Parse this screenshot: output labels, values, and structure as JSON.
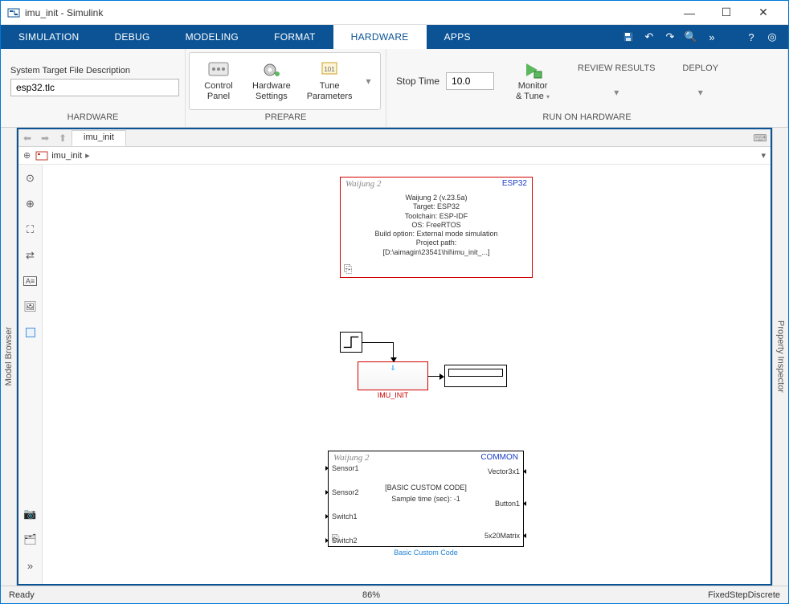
{
  "window": {
    "title": "imu_init - Simulink"
  },
  "tabs": [
    "SIMULATION",
    "DEBUG",
    "MODELING",
    "FORMAT",
    "HARDWARE",
    "APPS"
  ],
  "activeTab": "HARDWARE",
  "ribbon": {
    "hardware": {
      "targetLabel": "System Target File Description",
      "targetValue": "esp32.tlc",
      "groupLabel": "HARDWARE"
    },
    "prepare": {
      "controlPanel": "Control\nPanel",
      "hwSettings": "Hardware\nSettings",
      "tuneParams": "Tune\nParameters",
      "groupLabel": "PREPARE"
    },
    "run": {
      "stopTimeLabel": "Stop Time",
      "stopTimeValue": "10.0",
      "monitor": "Monitor\n& Tune",
      "review": "REVIEW RESULTS",
      "deploy": "DEPLOY",
      "groupLabel": "RUN ON HARDWARE"
    }
  },
  "fileTab": "imu_init",
  "breadcrumb": "imu_init",
  "sidebars": {
    "left": "Model Browser",
    "right": "Property Inspector"
  },
  "blocks": {
    "target": {
      "brand": "Waijung 2",
      "tag": "ESP32",
      "lines": [
        "Waijung 2 (v.23.5a)",
        "Target: ESP32",
        "Toolchain: ESP-IDF",
        "OS: FreeRTOS",
        "Build option: External mode simulation",
        "Project path:",
        "[D:\\aimagin\\23541\\hil\\imu_init_...]"
      ]
    },
    "imu": {
      "name": "IMU_INIT"
    },
    "custom": {
      "brand": "Waijung 2",
      "tag": "COMMON",
      "title": "[BASIC CUSTOM CODE]",
      "sample": "Sample time (sec): -1",
      "name": "Basic Custom Code",
      "in": [
        "Sensor1",
        "Sensor2",
        "Switch1",
        "Switch2"
      ],
      "out": [
        "Vector3x1",
        "Button1",
        "5x20Matrix"
      ]
    }
  },
  "status": {
    "ready": "Ready",
    "zoom": "86%",
    "solver": "FixedStepDiscrete"
  }
}
